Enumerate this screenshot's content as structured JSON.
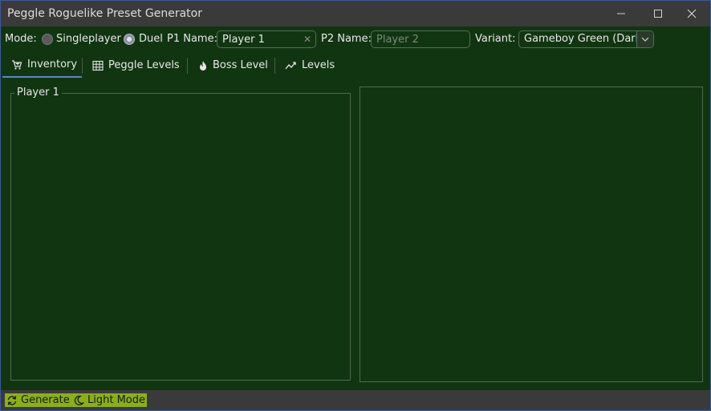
{
  "window": {
    "title": "Peggle Roguelike Preset Generator",
    "controls": [
      "minimize-icon",
      "maximize-icon",
      "close-icon"
    ]
  },
  "toolbar": {
    "mode_label": "Mode:",
    "mode_options": [
      "Singleplayer",
      "Duel"
    ],
    "mode_selected": "Duel",
    "p1_label": "P1 Name:",
    "p1_value": "Player 1",
    "p2_label": "P2 Name:",
    "p2_placeholder": "Player 2",
    "variant_label": "Variant:",
    "variant_value": "Gameboy Green (Dark)"
  },
  "tabs": [
    {
      "label": "Inventory",
      "icon": "cart-icon",
      "active": true
    },
    {
      "label": "Peggle Levels",
      "icon": "grid-icon",
      "active": false
    },
    {
      "label": "Boss Level",
      "icon": "flame-icon",
      "active": false
    },
    {
      "label": "Levels",
      "icon": "trend-icon",
      "active": false
    }
  ],
  "panels": {
    "left_title": "Player 1"
  },
  "statusbar": {
    "generate_label": "Generate",
    "lightmode_label": "Light Mode"
  },
  "colors": {
    "background": "#113511",
    "titlebar": "#3a3a3a",
    "accent_tab": "#5e86c6",
    "button_bg": "#8dae1b"
  }
}
